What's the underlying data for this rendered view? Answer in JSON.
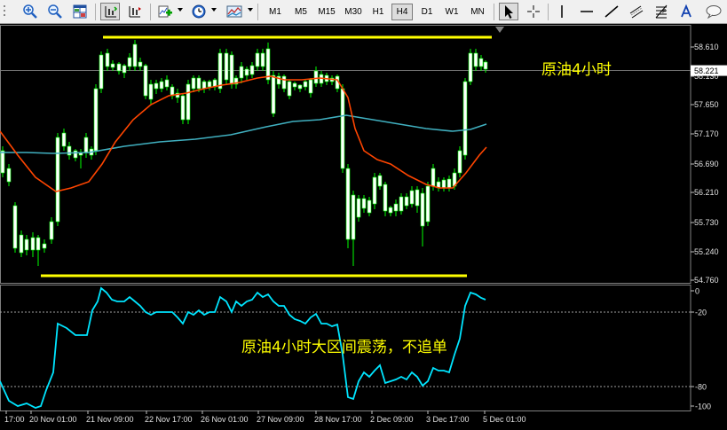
{
  "toolbar": {
    "timeframes": [
      "M1",
      "M5",
      "M15",
      "M30",
      "H1",
      "H4",
      "D1",
      "W1",
      "MN"
    ],
    "active_timeframe": "H4",
    "icons": [
      "zoom-in-icon",
      "zoom-out-icon",
      "tile-windows-icon",
      "scroll-chart-icon",
      "chart-shift-icon",
      "add-indicator-icon",
      "clock-icon",
      "templates-icon",
      "cursor-icon",
      "crosshair-icon",
      "vertical-line-icon",
      "horizontal-line-icon",
      "trendline-icon",
      "equidistant-channel-icon",
      "fibonacci-icon",
      "text-icon",
      "search-icon",
      "chat-icon"
    ]
  },
  "chart": {
    "current_price": "58.221",
    "price_ticks": [
      "58.610",
      "58.130",
      "57.650",
      "57.170",
      "56.690",
      "56.210",
      "55.730",
      "55.240",
      "54.760"
    ],
    "indicator_ticks": [
      "0",
      "-20",
      "-80",
      "-100"
    ],
    "time_labels": [
      "17:00",
      "20 Nov 01:00",
      "21 Nov 09:00",
      "22 Nov 17:00",
      "26 Nov 01:00",
      "27 Nov 09:00",
      "28 Nov 17:00",
      "2 Dec 09:00",
      "3 Dec 17:00",
      "5 Dec 01:00"
    ],
    "annotation_title": "原油4小时",
    "annotation_comment": "原油4小时大区间震荡，不追单",
    "colors": {
      "background": "#000000",
      "bull_candle": "#ffffff",
      "bear_candle": "#000000",
      "candle_outline": "#00ff00",
      "ma_fast": "#ff4500",
      "ma_slow": "#40b0c0",
      "indicator": "#00e5ff",
      "range_lines": "#ffff00",
      "annotation_text": "#ffff00"
    }
  }
}
